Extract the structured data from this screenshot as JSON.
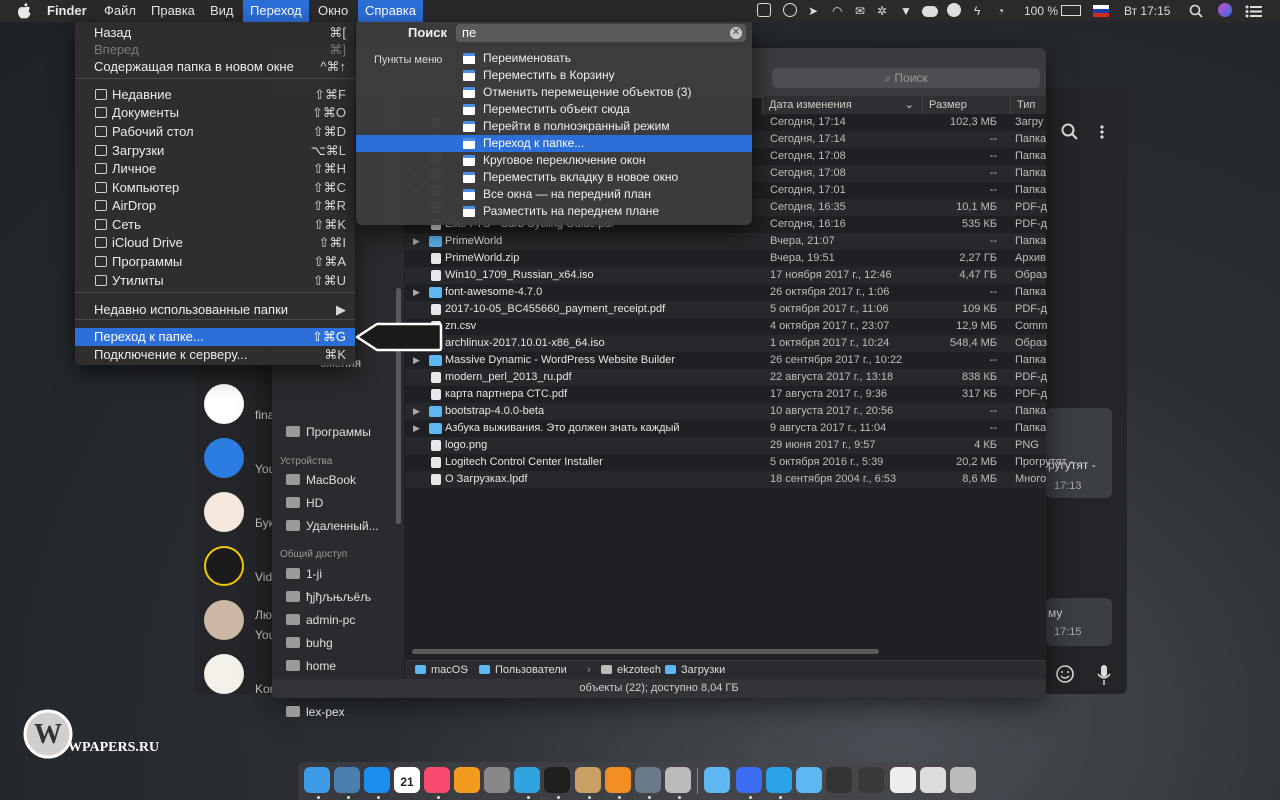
{
  "menubar": {
    "apple": "",
    "app": "Finder",
    "items": [
      "Файл",
      "Правка",
      "Вид",
      "Переход",
      "Окно",
      "Справка"
    ],
    "battery": "100 %",
    "clock": "Вт 17:15"
  },
  "go_menu": {
    "items": [
      {
        "label": "Назад",
        "shortcut": "⌘[",
        "disabled": false
      },
      {
        "label": "Вперед",
        "shortcut": "⌘]",
        "disabled": true
      },
      {
        "label": "Содержащая папка в новом окне",
        "shortcut": "^⌘↑",
        "disabled": false
      },
      {
        "label": "Недавние",
        "shortcut": "⇧⌘F",
        "icon": "clock-icon"
      },
      {
        "label": "Документы",
        "shortcut": "⇧⌘O",
        "icon": "documents-icon"
      },
      {
        "label": "Рабочий стол",
        "shortcut": "⇧⌘D",
        "icon": "desktop-icon"
      },
      {
        "label": "Загрузки",
        "shortcut": "⌥⌘L",
        "icon": "downloads-icon"
      },
      {
        "label": "Личное",
        "shortcut": "⇧⌘H",
        "icon": "home-icon"
      },
      {
        "label": "Компьютер",
        "shortcut": "⇧⌘C",
        "icon": "computer-icon"
      },
      {
        "label": "AirDrop",
        "shortcut": "⇧⌘R",
        "icon": "airdrop-icon"
      },
      {
        "label": "Сеть",
        "shortcut": "⇧⌘K",
        "icon": "network-icon"
      },
      {
        "label": "iCloud Drive",
        "shortcut": "⇧⌘I",
        "icon": "cloud-icon"
      },
      {
        "label": "Программы",
        "shortcut": "⇧⌘A",
        "icon": "apps-icon"
      },
      {
        "label": "Утилиты",
        "shortcut": "⇧⌘U",
        "icon": "utilities-icon"
      },
      {
        "label": "Недавно использованные папки",
        "shortcut": "▶"
      },
      {
        "label": "Переход к папке...",
        "shortcut": "⇧⌘G"
      },
      {
        "label": "Подключение к серверу...",
        "shortcut": "⌘K"
      }
    ]
  },
  "help_menu": {
    "search_label": "Поиск",
    "search_value": "пе",
    "items_label": "Пункты меню",
    "items": [
      "Переименовать",
      "Переместить в Корзину",
      "Отменить перемещение объектов (3)",
      "Переместить объект сюда",
      "Перейти в полноэкранный режим",
      "Переход к папке...",
      "Круговое переключение окон",
      "Переместить вкладку в новое окно",
      "Все окна — на передний план",
      "Разместить на переднем плане"
    ],
    "selected_index": 5
  },
  "finder": {
    "search_placeholder": "Поиск",
    "columns": {
      "date": "Дата изменения",
      "size": "Размер",
      "type": "Тип"
    },
    "sidebar": {
      "programs": "Программы",
      "devices_header": "Устройства",
      "devices": [
        "MacBook",
        "HD",
        "Удаленный..."
      ],
      "shared_header": "Общий доступ",
      "shared": [
        "1-ji",
        "ђјђљњљёљ",
        "admin-pc",
        "buhg",
        "home",
        "kassa-pc",
        "lex-pex"
      ],
      "partial": [
        "ие",
        "ожения"
      ]
    },
    "rows": [
      {
        "name": "",
        "date": "Сегодня, 17:14",
        "size": "102,3 МБ",
        "type": "Загру",
        "kind": "file"
      },
      {
        "name": "",
        "date": "Сегодня, 17:14",
        "size": "--",
        "type": "Папка",
        "kind": "folder"
      },
      {
        "name": "",
        "date": "Сегодня, 17:08",
        "size": "--",
        "type": "Папка",
        "kind": "folder"
      },
      {
        "name": "",
        "date": "Сегодня, 17:08",
        "size": "--",
        "type": "Папка",
        "kind": "folder"
      },
      {
        "name": "",
        "date": "Сегодня, 17:01",
        "size": "--",
        "type": "Папка",
        "kind": "folder"
      },
      {
        "name": "",
        "date": "Сегодня, 16:35",
        "size": "10,1 МБ",
        "type": "PDF-д",
        "kind": "file"
      },
      {
        "name": "Elite FTS - Carb Cycling Guide.pdf",
        "date": "Сегодня, 16:16",
        "size": "535 КБ",
        "type": "PDF-д",
        "kind": "file"
      },
      {
        "name": "PrimeWorld",
        "date": "Вчера, 21:07",
        "size": "--",
        "type": "Папка",
        "kind": "folder"
      },
      {
        "name": "PrimeWorld.zip",
        "date": "Вчера, 19:51",
        "size": "2,27 ГБ",
        "type": "Архив",
        "kind": "file"
      },
      {
        "name": "Win10_1709_Russian_x64.iso",
        "date": "17 ноября 2017 г., 12:46",
        "size": "4,47 ГБ",
        "type": "Образ",
        "kind": "file"
      },
      {
        "name": "font-awesome-4.7.0",
        "date": "26 октября 2017 г., 1:06",
        "size": "--",
        "type": "Папка",
        "kind": "folder"
      },
      {
        "name": "2017-10-05_BC455660_payment_receipt.pdf",
        "date": "5 октября 2017 г., 11:06",
        "size": "109 КБ",
        "type": "PDF-д",
        "kind": "file"
      },
      {
        "name": "zn.csv",
        "date": "4 октября 2017 г., 23:07",
        "size": "12,9 МБ",
        "type": "Comm",
        "kind": "file"
      },
      {
        "name": "archlinux-2017.10.01-x86_64.iso",
        "date": "1 октября 2017 г., 10:24",
        "size": "548,4 МБ",
        "type": "Образ",
        "kind": "file"
      },
      {
        "name": "Massive Dynamic - WordPress Website Builder",
        "date": "26 сентября 2017 г., 10:22",
        "size": "--",
        "type": "Папка",
        "kind": "folder"
      },
      {
        "name": "modern_perl_2013_ru.pdf",
        "date": "22 августа 2017 г., 13:18",
        "size": "838 КБ",
        "type": "PDF-д",
        "kind": "file"
      },
      {
        "name": "карта партнера СТС.pdf",
        "date": "17 августа 2017 г., 9:36",
        "size": "317 КБ",
        "type": "PDF-д",
        "kind": "file"
      },
      {
        "name": "bootstrap-4.0.0-beta",
        "date": "10 августа 2017 г., 20:56",
        "size": "--",
        "type": "Папка",
        "kind": "folder"
      },
      {
        "name": "Азбука выживания. Это должен знать каждый",
        "date": "9 августа 2017 г., 11:04",
        "size": "--",
        "type": "Папка",
        "kind": "folder"
      },
      {
        "name": "logo.png",
        "date": "29 июня 2017 г., 9:57",
        "size": "4 КБ",
        "type": "PNG",
        "kind": "file"
      },
      {
        "name": "Logitech Control Center Installer",
        "date": "5 октября 2016 г., 5:39",
        "size": "20,2 МБ",
        "type": "Прогрутят -",
        "kind": "file"
      },
      {
        "name": "О Загрузках.lpdf",
        "date": "18 сентября 2004 г., 6:53",
        "size": "8,6 МБ",
        "type": "Много",
        "kind": "file"
      }
    ],
    "path": [
      "macOS",
      "Пользователи",
      "ekzotech",
      "Загрузки"
    ],
    "status": "объекты (22); доступно 8,04 ГБ"
  },
  "chat": {
    "partial_names": [
      "fina",
      "You",
      "Бук",
      "Vid",
      "Лю",
      "You",
      "Kor"
    ],
    "bubble1_time": "17:13",
    "bubble1_text": "ругутят -",
    "bubble2_time": "17:15",
    "bubble2_text": "му"
  },
  "watermark": "WPAPERS.RU",
  "dock_calendar": "21"
}
